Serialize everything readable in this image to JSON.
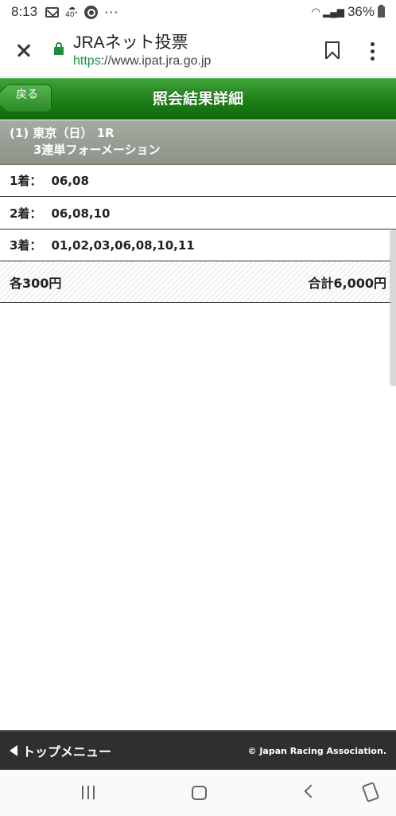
{
  "status_bar": {
    "time": "8:13",
    "weather_temp": "40°",
    "more": "···",
    "battery": "36%"
  },
  "browser": {
    "site_title": "JRAネット投票",
    "url_scheme": "https",
    "url_rest": "://www.ipat.jra.go.jp"
  },
  "header": {
    "back_label": "戻る",
    "title": "照会結果詳細"
  },
  "race": {
    "line1": "(1) 東京（日） 1R",
    "line2": "3連単フォーメーション"
  },
  "rows": [
    {
      "label": "1着：",
      "value": "06,08"
    },
    {
      "label": "2着：",
      "value": "06,08,10"
    },
    {
      "label": "3着：",
      "value": "01,02,03,06,08,10,11"
    }
  ],
  "summary": {
    "each": "各300円",
    "total": "合計6,000円"
  },
  "footer": {
    "top_menu": "トップメニュー",
    "copyright": "© Japan Racing Association."
  }
}
